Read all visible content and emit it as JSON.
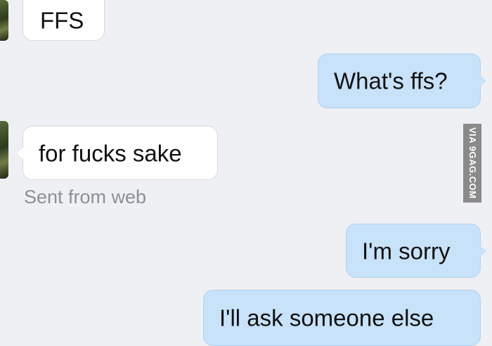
{
  "conversation": {
    "messages": [
      {
        "from": "them",
        "text": "FFS"
      },
      {
        "from": "me",
        "text": "What's ffs?"
      },
      {
        "from": "them",
        "text": "for fucks sake"
      },
      {
        "from": "me",
        "text": "I'm sorry"
      },
      {
        "from": "me",
        "text": "I'll ask someone else"
      }
    ],
    "meta_label": "Sent from web"
  },
  "watermark": {
    "text": "VIA 9GAG.COM"
  },
  "colors": {
    "background": "#eff0f4",
    "incoming_bubble": "#ffffff",
    "outgoing_bubble": "#c7e2f9"
  }
}
